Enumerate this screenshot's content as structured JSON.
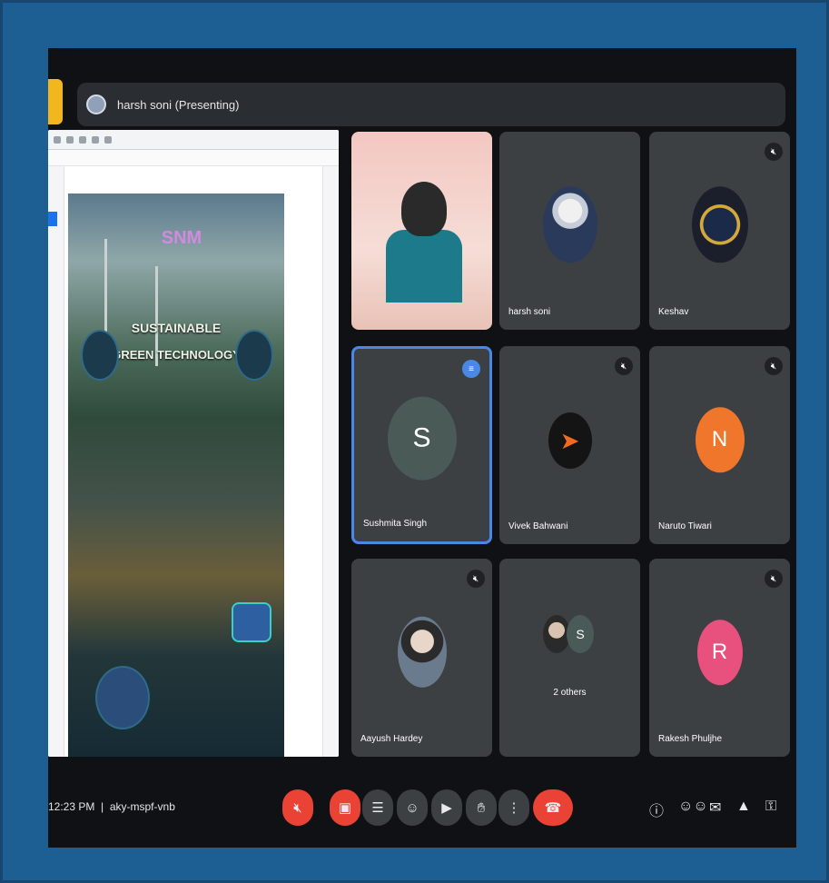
{
  "meeting": {
    "presenting_label": "harsh soni (Presenting)",
    "time": "12:23 PM",
    "meeting_code": "aky-mspf-vnb"
  },
  "poster": {
    "logo_text": "SNM",
    "title_line1": "SUSTAINABLE",
    "title_line2": "GREEN TECHNOLOGY"
  },
  "participants": [
    {
      "name": "",
      "type": "camera",
      "muted": false
    },
    {
      "name": "harsh soni",
      "type": "photo",
      "muted": false
    },
    {
      "name": "Keshav",
      "type": "photo",
      "muted": true
    },
    {
      "name": "Sushmita Singh",
      "type": "letter",
      "letter": "S",
      "color": "#4a5a57",
      "muted": false,
      "speaking": true
    },
    {
      "name": "Vivek Bahwani",
      "type": "logo",
      "muted": true
    },
    {
      "name": "Naruto Tiwari",
      "type": "letter",
      "letter": "N",
      "color": "#f0762b",
      "muted": true
    },
    {
      "name": "Aayush Hardey",
      "type": "photo",
      "muted": true
    },
    {
      "name": "2 others",
      "type": "group",
      "muted": false
    },
    {
      "name": "Rakesh Phuljhe",
      "type": "letter",
      "letter": "R",
      "color": "#e8507e",
      "muted": true
    }
  ],
  "controls": {
    "mic_icon": "mic-off-icon",
    "camera_icon": "camera-off-icon",
    "captions_icon": "captions-icon",
    "emoji_icon": "emoji-icon",
    "present_icon": "present-icon",
    "hand_icon": "raise-hand-icon",
    "more_icon": "more-icon",
    "end_icon": "end-call-icon"
  },
  "colors": {
    "accent": "#4a88e6",
    "danger": "#ea4335",
    "tile_bg": "#3c4043",
    "frame": "#1d5f93"
  }
}
